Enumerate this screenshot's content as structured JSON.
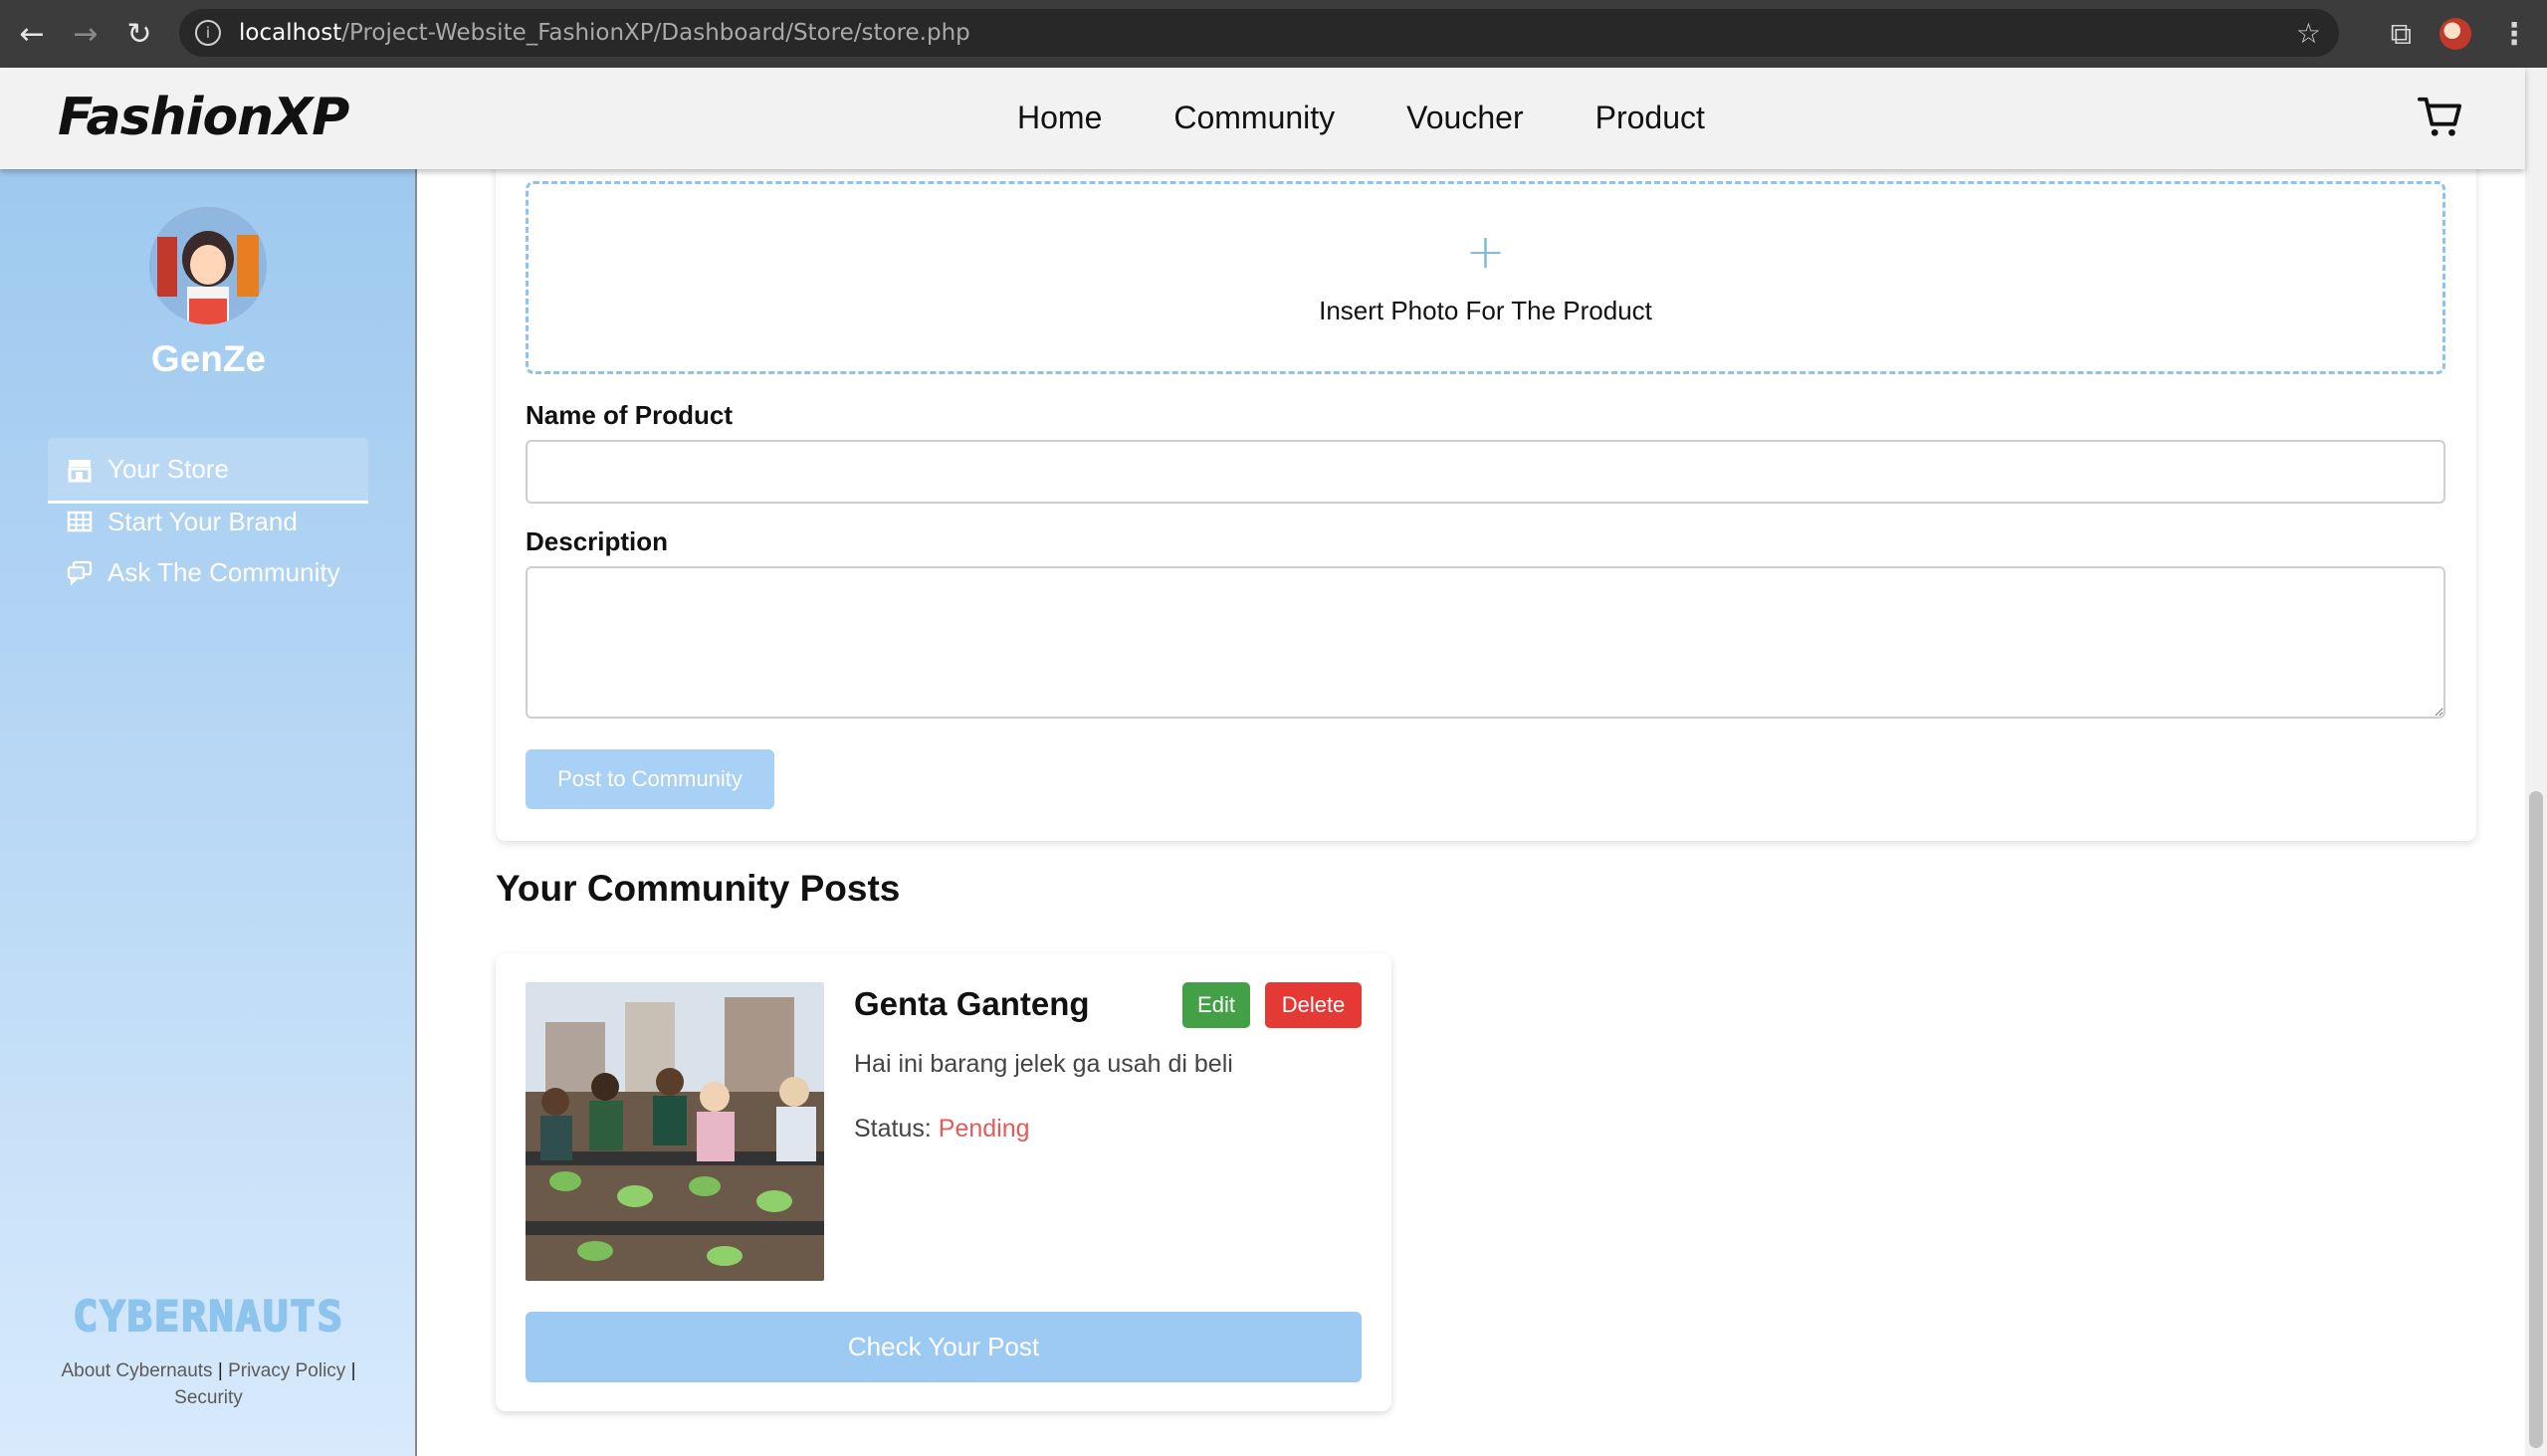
{
  "browser": {
    "url_host": "localhost",
    "url_path": "/Project-Website_FashionXP/Dashboard/Store/store.php"
  },
  "header": {
    "logo": "FashionXP",
    "nav": [
      "Home",
      "Community",
      "Voucher",
      "Product"
    ],
    "cart_icon": "cart-icon"
  },
  "sidebar": {
    "username": "GenZe",
    "items": [
      {
        "label": "Your Store",
        "icon": "store-icon",
        "active": true
      },
      {
        "label": "Start Your Brand",
        "icon": "grid-icon",
        "active": false
      },
      {
        "label": "Ask The Community",
        "icon": "chat-icon",
        "active": false
      }
    ],
    "brand": "CYBERNAUTS",
    "footer_links": [
      "About Cybernauts",
      "Privacy Policy",
      "Security"
    ],
    "footer_sep": "|"
  },
  "form": {
    "upload_icon": "+",
    "upload_label": "Insert Photo For The Product",
    "name_label": "Name of Product",
    "name_value": "",
    "description_label": "Description",
    "description_value": "",
    "submit_label": "Post to Community"
  },
  "posts_section": {
    "title": "Your Community Posts",
    "posts": [
      {
        "name": "Genta Ganteng",
        "edit_label": "Edit",
        "delete_label": "Delete",
        "description": "Hai ini barang jelek ga usah di beli",
        "status_label": "Status:",
        "status_value": "Pending",
        "check_label": "Check Your Post"
      }
    ]
  },
  "colors": {
    "primary_light": "#9ccaf3",
    "edit": "#43a047",
    "delete": "#e53935",
    "pending": "#e25c5c"
  }
}
